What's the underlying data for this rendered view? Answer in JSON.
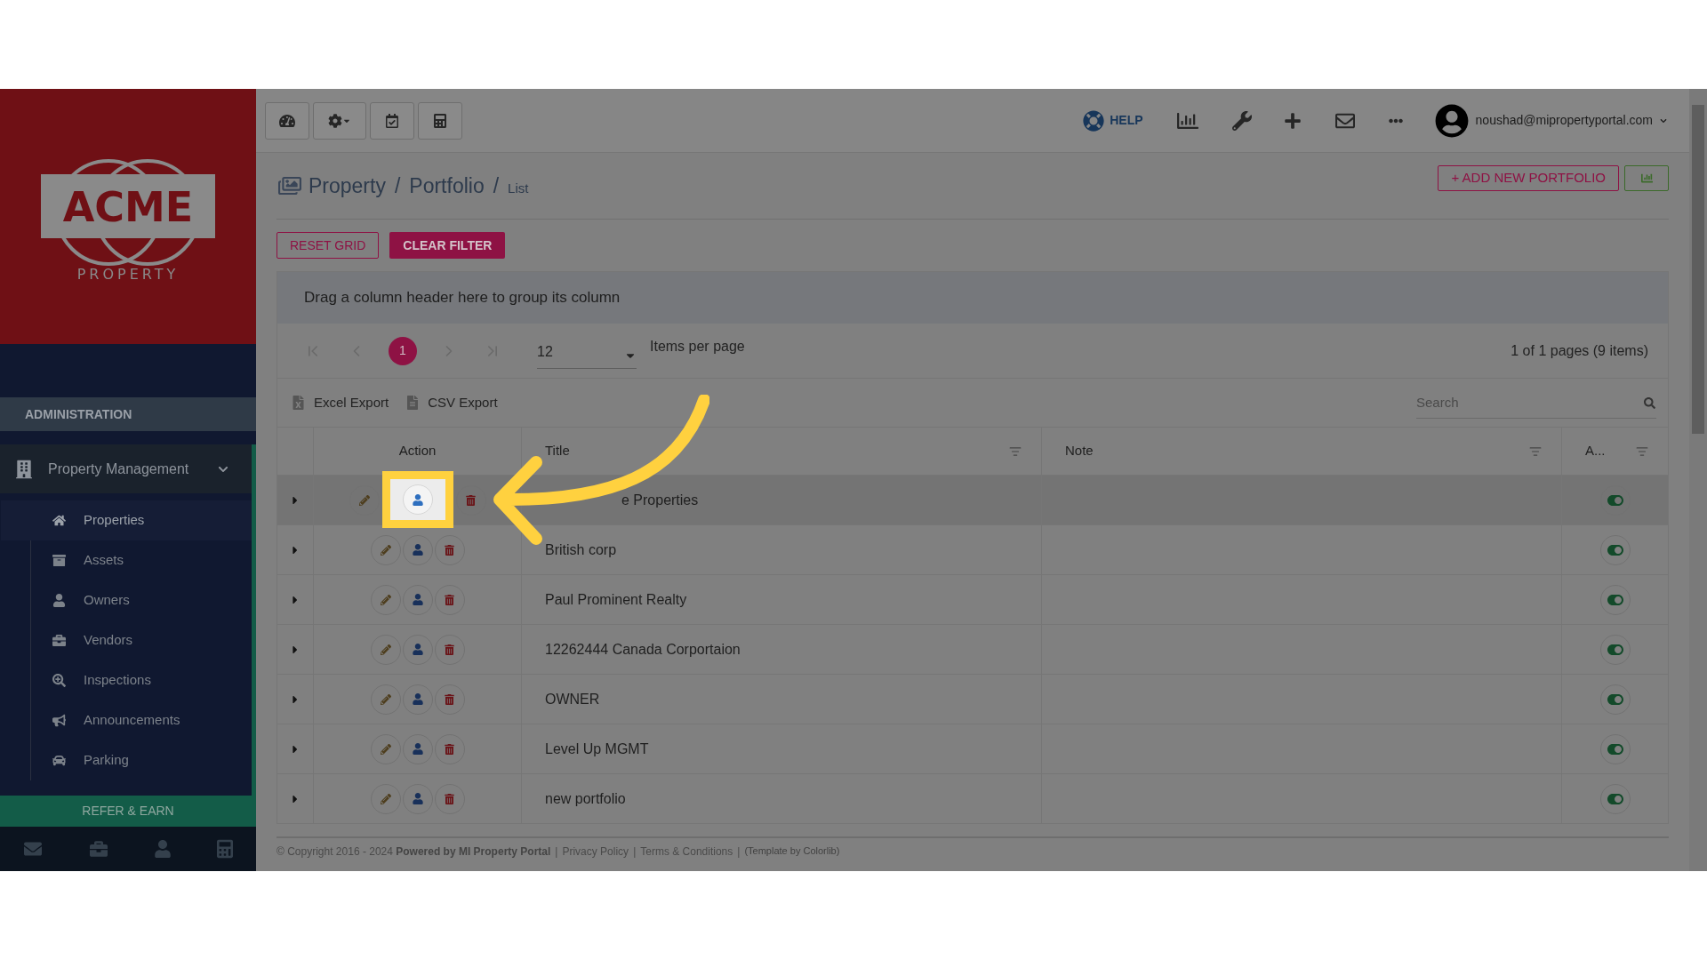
{
  "sidebar": {
    "logo": {
      "word": "ACME",
      "sub": "PROPERTY"
    },
    "section": "ADMINISTRATION",
    "group": {
      "label": "Property Management",
      "expanded": true
    },
    "items": [
      {
        "label": "Properties",
        "selected": true
      },
      {
        "label": "Assets",
        "selected": false
      },
      {
        "label": "Owners",
        "selected": false
      },
      {
        "label": "Vendors",
        "selected": false
      },
      {
        "label": "Inspections",
        "selected": false
      },
      {
        "label": "Announcements",
        "selected": false
      },
      {
        "label": "Parking",
        "selected": false
      }
    ],
    "refer": "REFER & EARN"
  },
  "topbar": {
    "help": "HELP",
    "user": "noushad@mipropertyportal.com"
  },
  "breadcrumb": {
    "parts": [
      "Property",
      "Portfolio"
    ],
    "separators": [
      "/",
      "/"
    ],
    "current": "List",
    "add_button": "+ ADD NEW PORTFOLIO"
  },
  "buttons": {
    "reset": "RESET GRID",
    "clear": "CLEAR FILTER"
  },
  "grid": {
    "group_hint": "Drag a column header here to group its column",
    "pager": {
      "page": "1",
      "page_size": "12",
      "page_size_label": "Items per page",
      "info": "1 of 1 pages (9 items)"
    },
    "exports": [
      "Excel Export",
      "CSV Export"
    ],
    "search_placeholder": "Search",
    "columns": [
      "Action",
      "Title",
      "Note",
      "A..."
    ],
    "rows": [
      {
        "title": "e Properties",
        "on": true,
        "highlighted": true
      },
      {
        "title": "British corp",
        "on": true,
        "highlighted": false
      },
      {
        "title": "Paul Prominent Realty",
        "on": true,
        "highlighted": false
      },
      {
        "title": "12262444 Canada Corportaion",
        "on": true,
        "highlighted": false
      },
      {
        "title": "OWNER",
        "on": true,
        "highlighted": false
      },
      {
        "title": "Level Up MGMT",
        "on": true,
        "highlighted": false
      },
      {
        "title": "new portfolio",
        "on": true,
        "highlighted": false
      }
    ]
  },
  "footer": {
    "copyright": "© Copyright 2016 - 2024",
    "powered": "Powered by MI Property Portal",
    "separators": [
      "|",
      "|",
      "|"
    ],
    "links": [
      "Privacy Policy",
      "Terms & Conditions"
    ],
    "template": "(Template by Colorlib)"
  }
}
